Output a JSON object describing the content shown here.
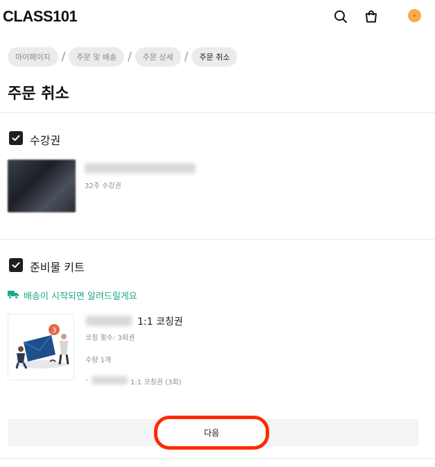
{
  "header": {
    "logo": "CLASS101",
    "icons": [
      "search-icon",
      "shopping-bag-icon",
      "avatar"
    ]
  },
  "breadcrumb": {
    "items": [
      "마이페이지",
      "주문 및 배송",
      "주문 상세",
      "주문 취소"
    ],
    "separator": "/"
  },
  "page": {
    "title": "주문 취소"
  },
  "pass_section": {
    "label": "수강권",
    "item": {
      "subtitle": "32주 수강권"
    }
  },
  "kit_section": {
    "label": "준비물 키트",
    "shipping_notice": "배송이 시작되면 알려드릴게요",
    "item": {
      "title_suffix": "1:1 코칭권",
      "coaching_count": "코칭 횟수: 3회권",
      "quantity": "수량 1개",
      "option_prefix": "-",
      "option_suffix": "1:1 코칭권 (3회)"
    }
  },
  "footer": {
    "next_label": "다음"
  },
  "colors": {
    "accent_green": "#1aa88a",
    "highlight": "#ff2a00",
    "avatar": "#f7a94b"
  }
}
